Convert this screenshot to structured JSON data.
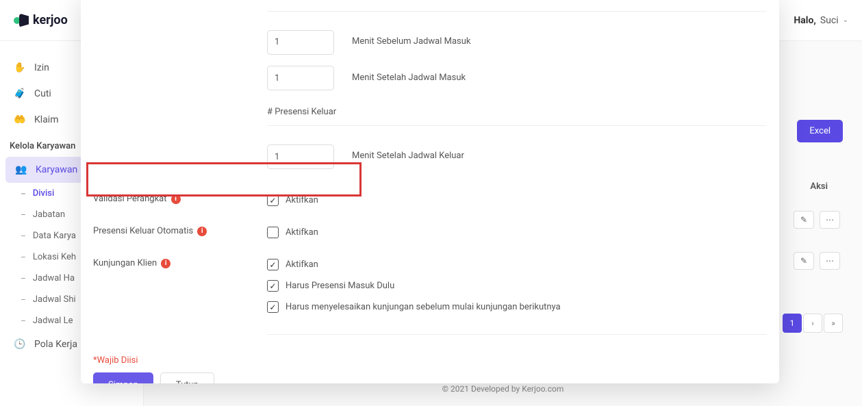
{
  "header": {
    "brand": "kerjoo",
    "greeting_label": "Halo,",
    "greeting_name": "Suci"
  },
  "sidebar": {
    "items": {
      "izin": "Izin",
      "cuti": "Cuti",
      "klaim": "Klaim"
    },
    "section_title": "Kelola Karyawan",
    "karyawan": "Karyawan",
    "subs": {
      "divisi": "Divisi",
      "jabatan": "Jabatan",
      "data": "Data Karya",
      "lokasi": "Lokasi Keh",
      "jadwal_ha": "Jadwal Ha",
      "jadwal_shi": "Jadwal Shi",
      "jadwal_le": "Jadwal Le"
    },
    "pola_kerja": "Pola Kerja"
  },
  "mainbg": {
    "excel": "Excel",
    "aksi": "Aksi",
    "page1": "1",
    "footer": "© 2021 Developed by Kerjoo.com"
  },
  "modal": {
    "fields": {
      "before_masuk": {
        "value": "1",
        "label": "Menit Sebelum Jadwal Masuk"
      },
      "after_masuk": {
        "value": "1",
        "label": "Menit Setelah Jadwal Masuk"
      },
      "presensi_keluar_heading": "# Presensi Keluar",
      "after_keluar": {
        "value": "1",
        "label": "Menit Setelah Jadwal Keluar"
      }
    },
    "validasi": {
      "label": "Validasi Perangkat",
      "aktifkan": "Aktifkan"
    },
    "presensi_otomatis": {
      "label": "Presensi Keluar Otomatis",
      "aktifkan": "Aktifkan"
    },
    "kunjungan": {
      "label": "Kunjungan Klien",
      "aktifkan": "Aktifkan",
      "presensi_dulu": "Harus Presensi Masuk Dulu",
      "selesaikan": "Harus menyelesaikan kunjungan sebelum mulai kunjungan berikutnya"
    },
    "required_note": "*Wajib Diisi",
    "save": "Simpan",
    "close": "Tutup"
  }
}
